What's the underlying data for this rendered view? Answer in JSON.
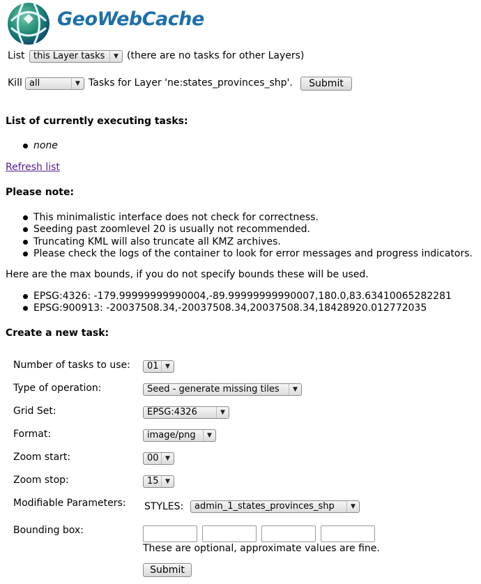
{
  "logo": {
    "text": "GeoWebCache"
  },
  "list_row": {
    "prefix": "List",
    "select_value": "this Layer tasks",
    "suffix": "(there are no tasks for other Layers)"
  },
  "kill_row": {
    "prefix": "Kill",
    "select_value": "all",
    "suffix": "Tasks for Layer 'ne:states_provinces_shp'.",
    "submit_label": "Submit"
  },
  "executing": {
    "heading": "List of currently executing tasks:",
    "items": [
      "none"
    ]
  },
  "refresh_link": "Refresh list",
  "notes": {
    "heading": "Please note:",
    "items": [
      "This minimalistic interface does not check for correctness.",
      "Seeding past zoomlevel 20 is usually not recommended.",
      "Truncating KML will also truncate all KMZ archives.",
      "Please check the logs of the container to look for error messages and progress indicators."
    ]
  },
  "bounds": {
    "intro": "Here are the max bounds, if you do not specify bounds these will be used.",
    "items": [
      "EPSG:4326: -179.99999999990004,-89.99999999990007,180.0,83.63410065282281",
      "EPSG:900913: -20037508.34,-20037508.34,20037508.34,18428920.012772035"
    ]
  },
  "create_task": {
    "heading": "Create a new task:",
    "num_tasks": {
      "label": "Number of tasks to use:",
      "value": "01"
    },
    "operation": {
      "label": "Type of operation:",
      "value": "Seed - generate missing tiles"
    },
    "grid_set": {
      "label": "Grid Set:",
      "value": "EPSG:4326"
    },
    "format": {
      "label": "Format:",
      "value": "image/png"
    },
    "zoom_start": {
      "label": "Zoom start:",
      "value": "00"
    },
    "zoom_stop": {
      "label": "Zoom stop:",
      "value": "15"
    },
    "params": {
      "label": "Modifiable Parameters:",
      "styles_label": "STYLES:",
      "styles_value": "admin_1_states_provinces_shp"
    },
    "bbox": {
      "label": "Bounding box:",
      "minx": "",
      "miny": "",
      "maxx": "",
      "maxy": "",
      "hint": "These are optional, approximate values are fine."
    },
    "submit_label": "Submit"
  }
}
